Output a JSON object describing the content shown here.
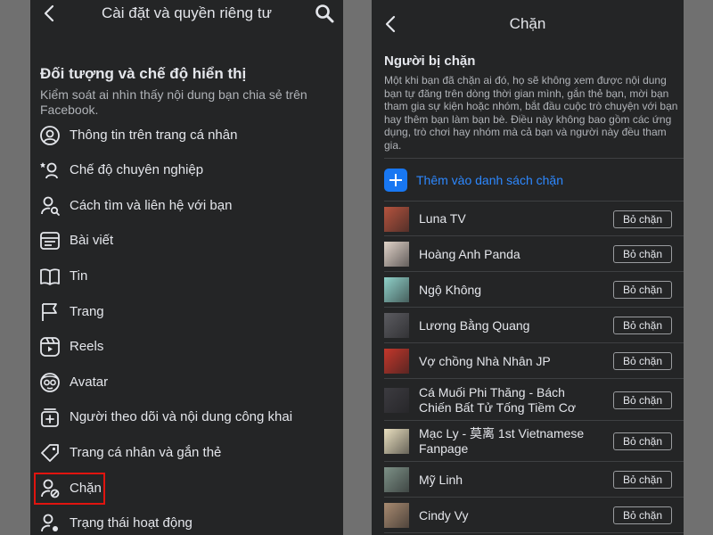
{
  "left_screen": {
    "header": {
      "title": "Cài đặt và quyền riêng tư"
    },
    "section": {
      "title": "Đối tượng và chế độ hiển thị",
      "description": "Kiểm soát ai nhìn thấy nội dung bạn chia sẻ trên Facebook."
    },
    "items": [
      {
        "label": "Thông tin trên trang cá nhân",
        "icon": "profile-icon"
      },
      {
        "label": "Chế độ chuyên nghiệp",
        "icon": "professional-mode-icon"
      },
      {
        "label": "Cách tìm và liên hệ với bạn",
        "icon": "user-search-icon"
      },
      {
        "label": "Bài viết",
        "icon": "posts-icon"
      },
      {
        "label": "Tin",
        "icon": "book-icon"
      },
      {
        "label": "Trang",
        "icon": "flag-icon"
      },
      {
        "label": "Reels",
        "icon": "reels-icon"
      },
      {
        "label": "Avatar",
        "icon": "avatar-icon"
      },
      {
        "label": "Người theo dõi và nội dung công khai",
        "icon": "followers-icon"
      },
      {
        "label": "Trang cá nhân và gắn thẻ",
        "icon": "tag-icon"
      },
      {
        "label": "Chặn",
        "icon": "block-user-icon",
        "highlighted": true
      },
      {
        "label": "Trạng thái hoạt động",
        "icon": "activity-status-icon"
      }
    ]
  },
  "right_screen": {
    "header": {
      "title": "Chặn"
    },
    "section": {
      "title": "Người bị chặn",
      "description": "Một khi bạn đã chặn ai đó, họ sẽ không xem được nội dung bạn tự đăng trên dòng thời gian mình, gắn thẻ bạn, mời bạn tham gia sự kiện hoặc nhóm, bắt đầu cuộc trò chuyện với bạn hay thêm bạn làm bạn bè. Điều này không bao gồm các ứng dụng, trò chơi hay nhóm mà cả bạn và người này đều tham gia."
    },
    "add_label": "Thêm vào danh sách chặn",
    "unblock_label": "Bỏ chặn",
    "blocked": [
      {
        "name": "Luna TV",
        "avatar_color": "#b5533e"
      },
      {
        "name": "Hoàng Anh Panda",
        "avatar_color": "#e0d2c8"
      },
      {
        "name": "Ngộ Không",
        "avatar_color": "#8fd1c9"
      },
      {
        "name": "Lương Bằng Quang",
        "avatar_color": "#5b5b60"
      },
      {
        "name": "Vợ chồng Nhà Nhân JP",
        "avatar_color": "#c4372b"
      },
      {
        "name": "Cá Muối Phi Thăng - Bách Chiến Bất Tử Tống Tiềm Cơ",
        "avatar_color": "#3c3b40"
      },
      {
        "name": "Mạc Ly - 莫离 1st Vietnamese Fanpage",
        "avatar_color": "#e9dfbf"
      },
      {
        "name": "Mỹ Linh",
        "avatar_color": "#7d9187"
      },
      {
        "name": "Cindy Vy",
        "avatar_color": "#a88a70"
      }
    ]
  },
  "colors": {
    "panel": "#242526",
    "accent": "#2d88ff",
    "highlight": "#e1140f",
    "backdrop": "#707070"
  }
}
